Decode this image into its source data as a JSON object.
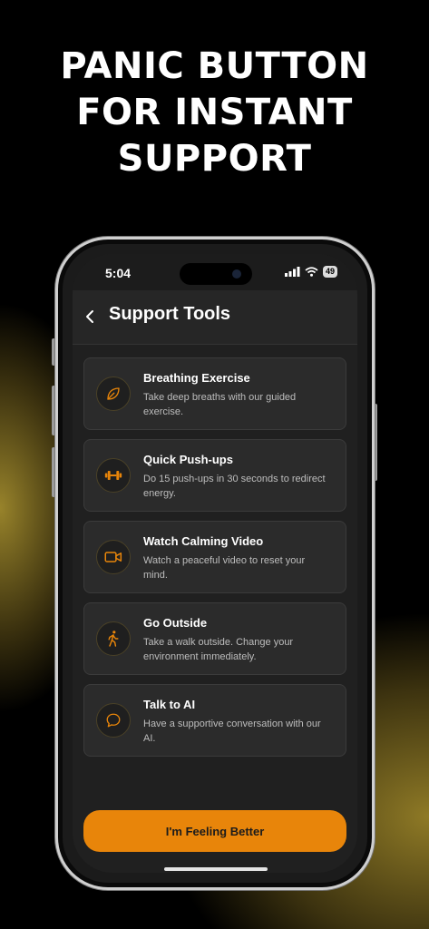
{
  "headline": {
    "line1": "PANIC BUTTON",
    "line2": "FOR INSTANT",
    "line3": "SUPPORT"
  },
  "status_bar": {
    "time": "5:04",
    "battery": "49"
  },
  "header": {
    "title": "Support Tools",
    "back_icon": "chevron-left-icon"
  },
  "tools": [
    {
      "title": "Breathing Exercise",
      "description": "Take deep breaths with our guided exercise.",
      "icon": "leaf-icon"
    },
    {
      "title": "Quick Push-ups",
      "description": "Do 15 push-ups in 30 seconds to redirect energy.",
      "icon": "dumbbell-icon"
    },
    {
      "title": "Watch Calming Video",
      "description": "Watch a peaceful video to reset your mind.",
      "icon": "video-icon"
    },
    {
      "title": "Go Outside",
      "description": "Take a walk outside. Change your environment immediately.",
      "icon": "walking-icon"
    },
    {
      "title": "Talk to AI",
      "description": "Have a supportive conversation with our AI.",
      "icon": "chat-bubble-icon"
    }
  ],
  "cta": {
    "label": "I'm Feeling Better"
  },
  "colors": {
    "accent": "#e8850a",
    "background": "#202020",
    "card": "#2b2b2b",
    "icon": "#e8850a"
  }
}
